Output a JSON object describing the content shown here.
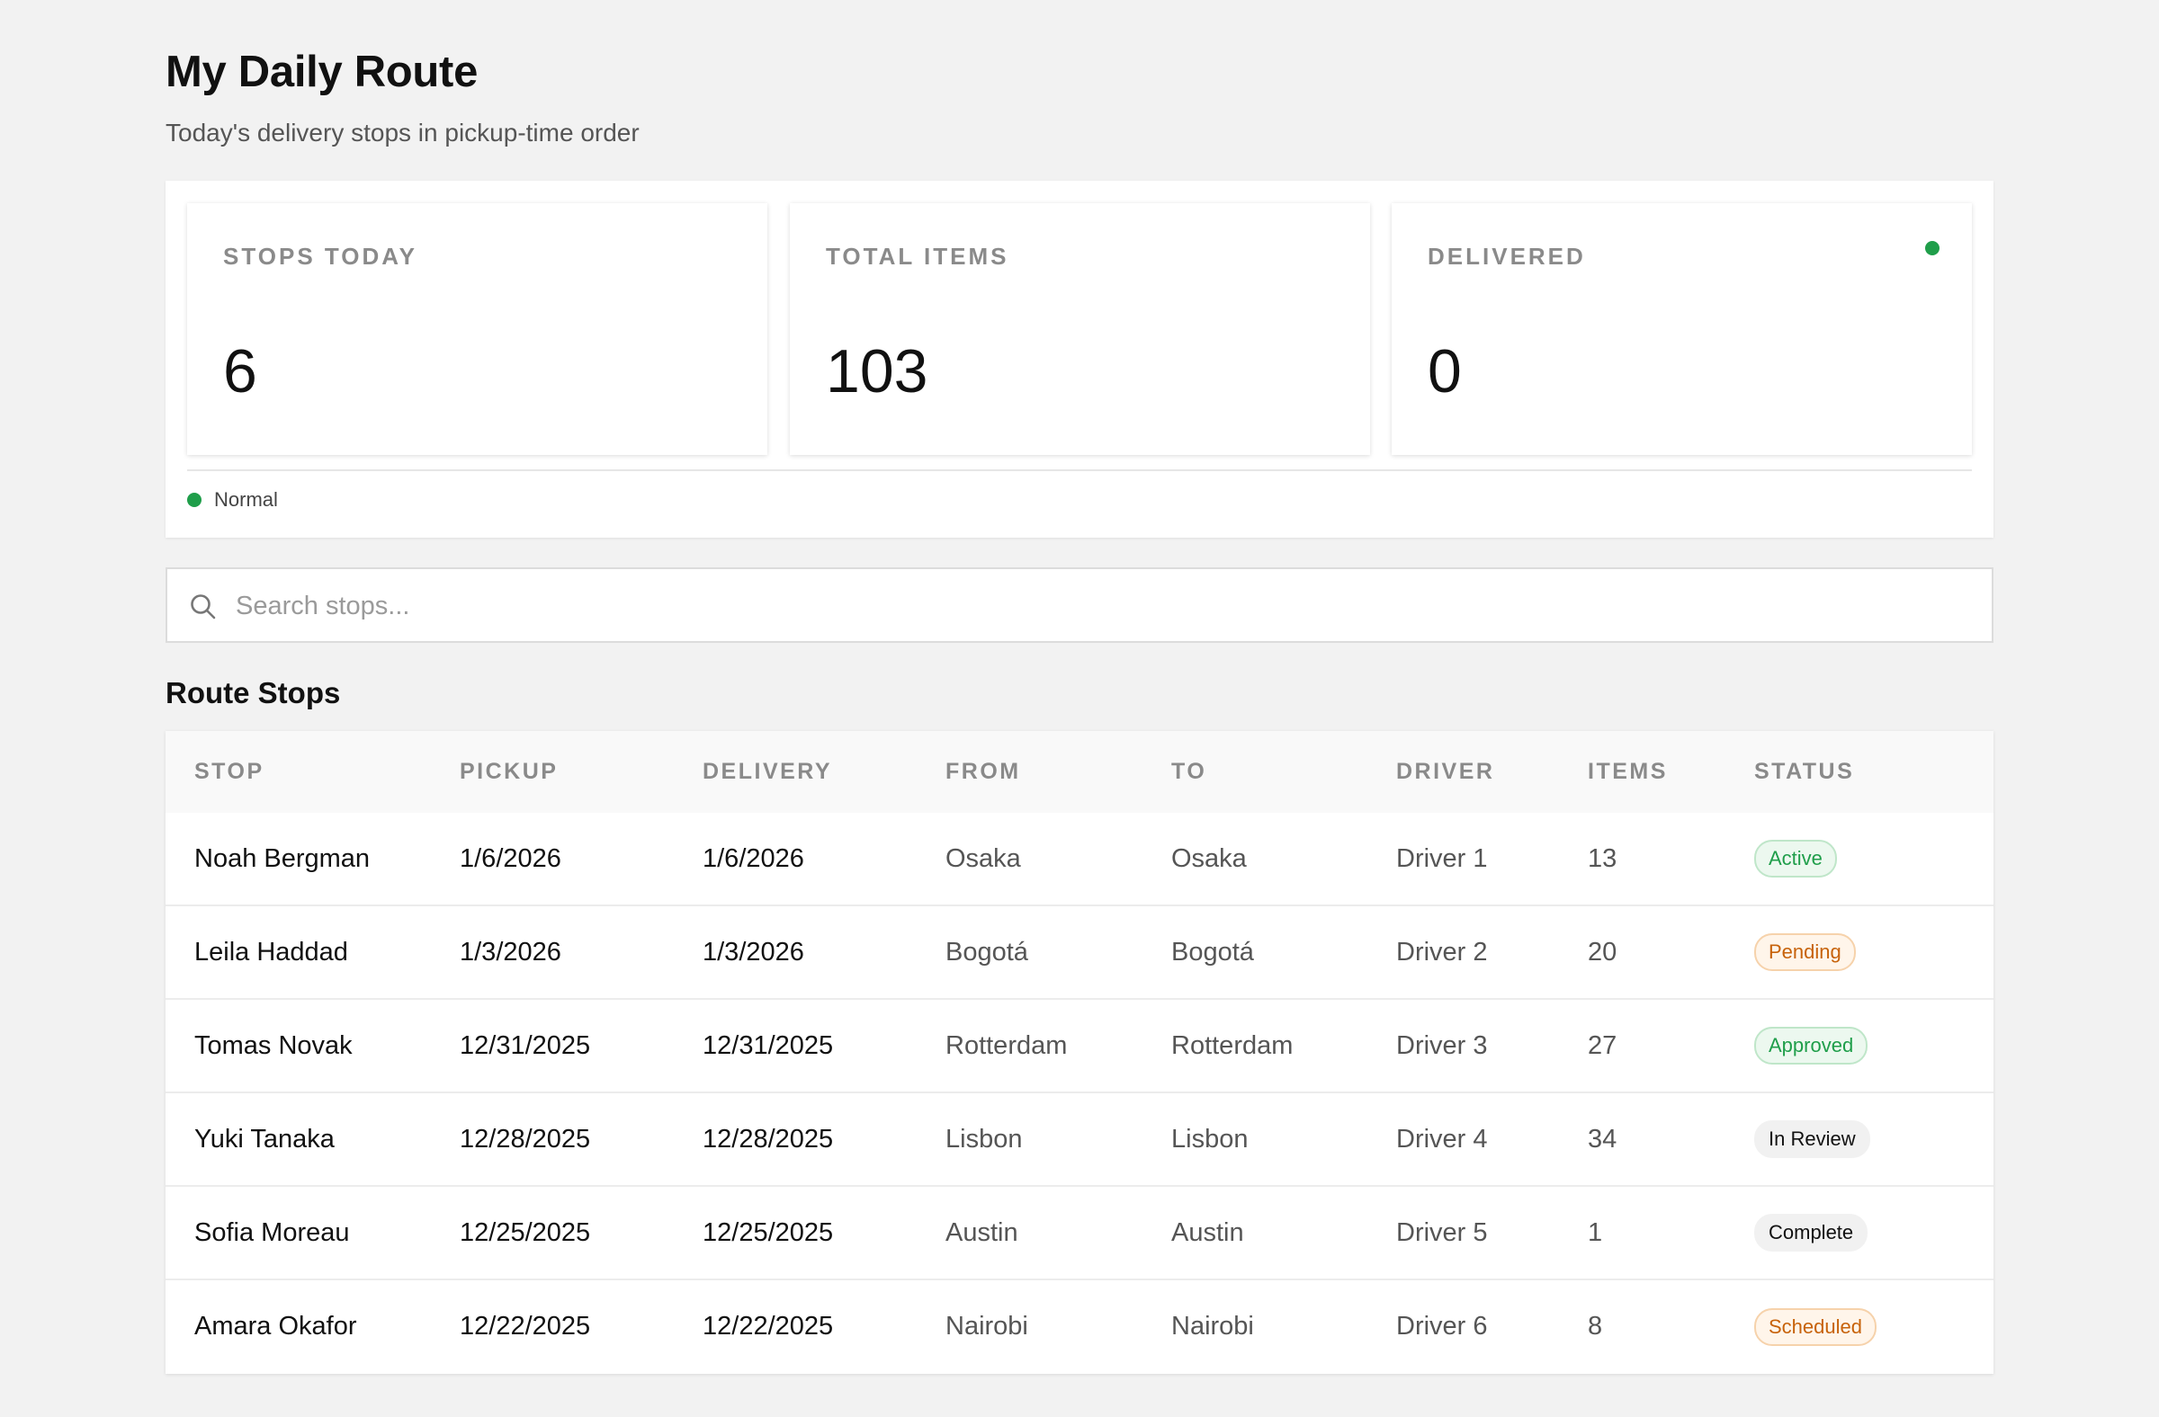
{
  "header": {
    "title": "My Daily Route",
    "subtitle": "Today's delivery stops in pickup-time order"
  },
  "stats": [
    {
      "label": "STOPS TODAY",
      "value": "6"
    },
    {
      "label": "TOTAL ITEMS",
      "value": "103"
    },
    {
      "label": "DELIVERED",
      "value": "0"
    }
  ],
  "legend": {
    "label": "Normal",
    "color": "#1f9e4a"
  },
  "search": {
    "placeholder": "Search stops...",
    "value": ""
  },
  "table": {
    "title": "Route Stops",
    "columns": [
      "STOP",
      "PICKUP",
      "DELIVERY",
      "FROM",
      "TO",
      "DRIVER",
      "ITEMS",
      "STATUS"
    ],
    "rows": [
      {
        "stop": "Noah Bergman",
        "pickup": "1/6/2026",
        "delivery": "1/6/2026",
        "from": "Osaka",
        "to": "Osaka",
        "driver": "Driver 1",
        "items": "13",
        "status": "Active",
        "status_color": "green"
      },
      {
        "stop": "Leila Haddad",
        "pickup": "1/3/2026",
        "delivery": "1/3/2026",
        "from": "Bogotá",
        "to": "Bogotá",
        "driver": "Driver 2",
        "items": "20",
        "status": "Pending",
        "status_color": "orange"
      },
      {
        "stop": "Tomas Novak",
        "pickup": "12/31/2025",
        "delivery": "12/31/2025",
        "from": "Rotterdam",
        "to": "Rotterdam",
        "driver": "Driver 3",
        "items": "27",
        "status": "Approved",
        "status_color": "green"
      },
      {
        "stop": "Yuki Tanaka",
        "pickup": "12/28/2025",
        "delivery": "12/28/2025",
        "from": "Lisbon",
        "to": "Lisbon",
        "driver": "Driver 4",
        "items": "34",
        "status": "In Review",
        "status_color": "gray"
      },
      {
        "stop": "Sofia Moreau",
        "pickup": "12/25/2025",
        "delivery": "12/25/2025",
        "from": "Austin",
        "to": "Austin",
        "driver": "Driver 5",
        "items": "1",
        "status": "Complete",
        "status_color": "gray"
      },
      {
        "stop": "Amara Okafor",
        "pickup": "12/22/2025",
        "delivery": "12/22/2025",
        "from": "Nairobi",
        "to": "Nairobi",
        "driver": "Driver 6",
        "items": "8",
        "status": "Scheduled",
        "status_color": "orange"
      }
    ]
  },
  "colors": {
    "accent_green": "#1f9e4a",
    "accent_orange": "#c7620a",
    "background": "#f2f2f2"
  }
}
